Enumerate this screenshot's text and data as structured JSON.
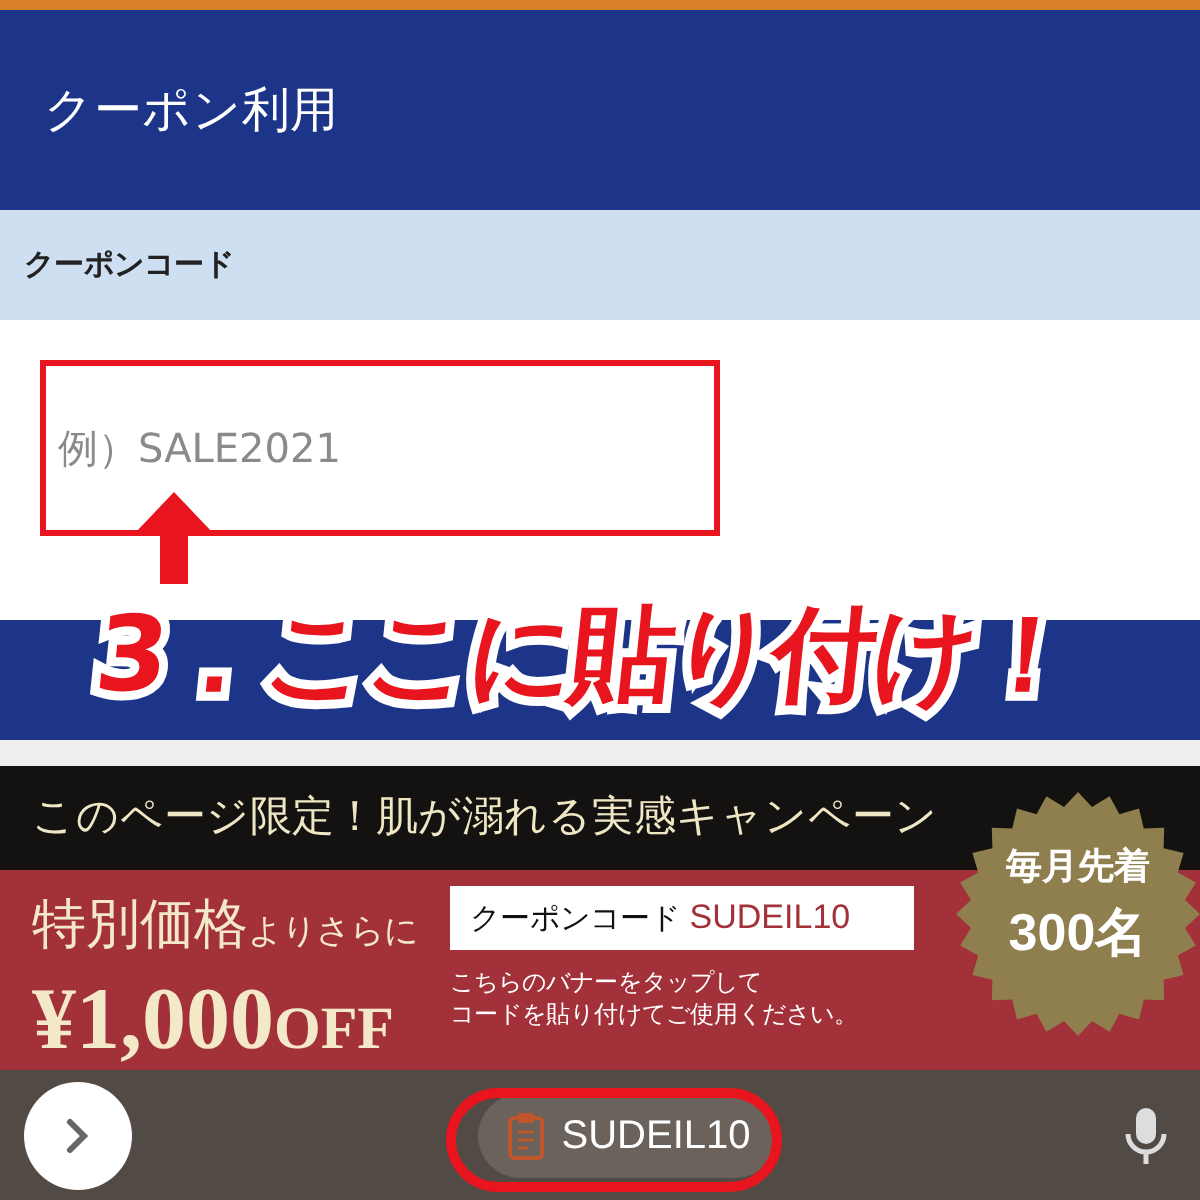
{
  "header": {
    "title": "クーポン利用"
  },
  "coupon_section": {
    "label": "クーポンコード",
    "input": {
      "placeholder": "例）SALE2021"
    }
  },
  "annotation": {
    "text": "3．ここに貼り付け！"
  },
  "banner": {
    "headline": "このページ限定！肌が溺れる実感キャンペーン",
    "price_lead": "特別価格",
    "price_lead_small": "よりさらに",
    "discount": "¥1,000",
    "discount_suffix": "OFF",
    "coupon_label": "クーポンコード",
    "coupon_code": "SUDEIL10",
    "instructions": [
      "こちらのバナーをタップして",
      "コードを貼り付けてご使用ください。"
    ],
    "seal_line1": "毎月先着",
    "seal_line2": "300名"
  },
  "keyboard_bar": {
    "suggestion": "SUDEIL10"
  }
}
